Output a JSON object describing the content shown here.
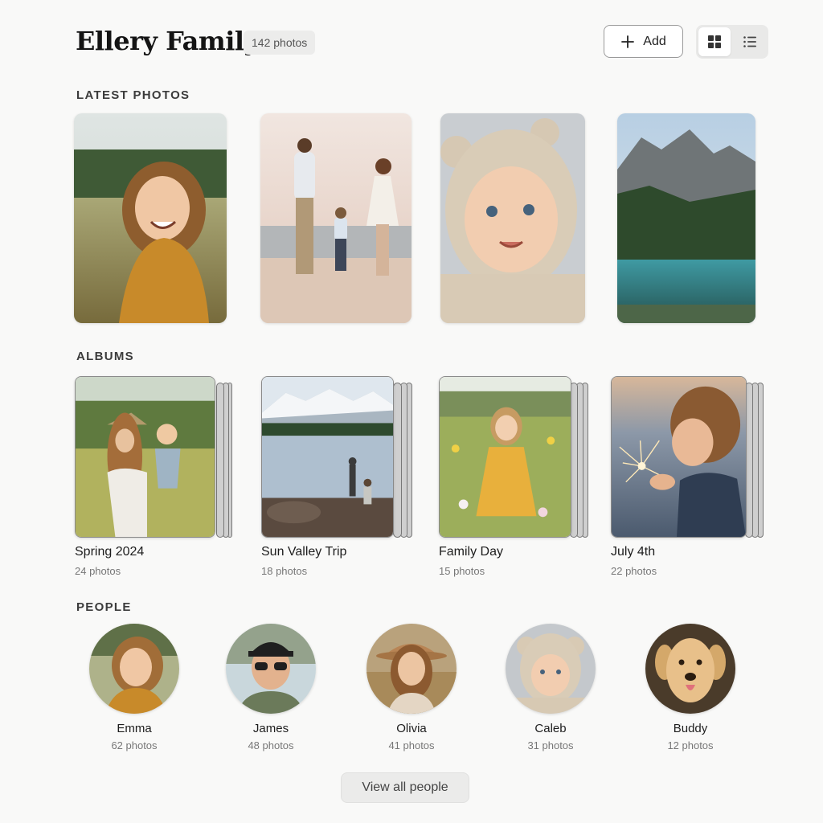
{
  "header": {
    "title": "Ellery Family",
    "photo_count": "142 photos",
    "add_label": "Add",
    "views": [
      {
        "icon": "grid-view-icon",
        "active": true
      },
      {
        "icon": "list-view-icon",
        "active": false
      }
    ]
  },
  "sections": {
    "latest": "LATEST PHOTOS",
    "albums": "ALBUMS",
    "people": "PEOPLE"
  },
  "latest_photos": [
    {
      "subject": "laughing girl in yellow dress in meadow"
    },
    {
      "subject": "family walking on beach at sunset"
    },
    {
      "subject": "baby in knitted bear hat"
    },
    {
      "subject": "mountain lake landscape"
    }
  ],
  "albums": [
    {
      "name": "Spring 2024",
      "count": "24 photos"
    },
    {
      "name": "Sun Valley Trip",
      "count": "18 photos"
    },
    {
      "name": "Family Day",
      "count": "15 photos"
    },
    {
      "name": "July 4th",
      "count": "22 photos"
    }
  ],
  "people": [
    {
      "name": "Emma",
      "count": "62 photos"
    },
    {
      "name": "James",
      "count": "48 photos"
    },
    {
      "name": "Olivia",
      "count": "41 photos"
    },
    {
      "name": "Caleb",
      "count": "31 photos"
    },
    {
      "name": "Buddy",
      "count": "12 photos"
    }
  ],
  "view_all_label": "View all people",
  "colors": {
    "background": "#f9f9f8",
    "badge": "#ececeb",
    "toggle_bg": "#e9e9e8"
  }
}
